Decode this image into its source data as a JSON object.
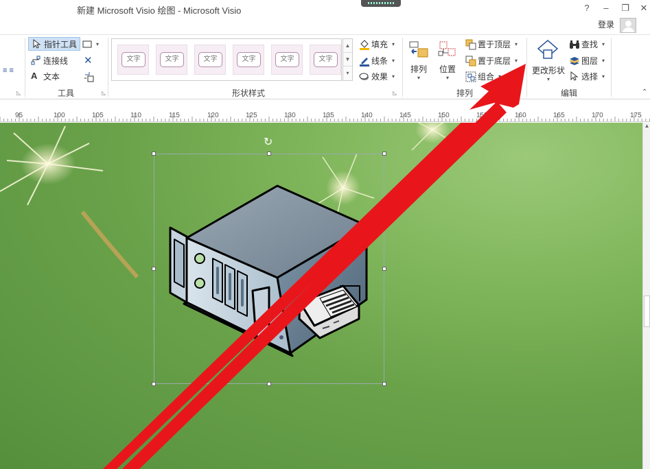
{
  "window": {
    "title": "新建 Microsoft Visio 绘图 - Microsoft Visio",
    "help": "?",
    "minimize": "–",
    "restore": "❐",
    "close": "✕",
    "login": "登录",
    "ribbon_close": "✕"
  },
  "ribbon": {
    "tools_group": {
      "label": "工具",
      "pointer": "指针工具",
      "connector": "连接线",
      "text": "文本"
    },
    "shape_styles_group": {
      "label": "形状样式",
      "swatches": [
        "文字",
        "文字",
        "文字",
        "文字",
        "文字",
        "文字"
      ],
      "fill": "填充",
      "line": "线条",
      "effects": "效果"
    },
    "arrange_group": {
      "label": "排列",
      "arrange": "排列",
      "position": "位置",
      "bring_front": "置于顶层",
      "send_back": "置于底层",
      "group": "组合"
    },
    "edit_group": {
      "label": "编辑",
      "change_shape": "更改形状",
      "find": "查找",
      "layers": "图层",
      "select": "选择"
    }
  },
  "ruler": {
    "ticks": [
      "95",
      "100",
      "105",
      "110",
      "115",
      "120",
      "125",
      "130",
      "135",
      "140",
      "145",
      "150",
      "155",
      "160",
      "165",
      "170",
      "175"
    ]
  },
  "colors": {
    "accent": "#2b579a",
    "arrow": "#e8161b",
    "canvas_green": "#6aa24a"
  }
}
